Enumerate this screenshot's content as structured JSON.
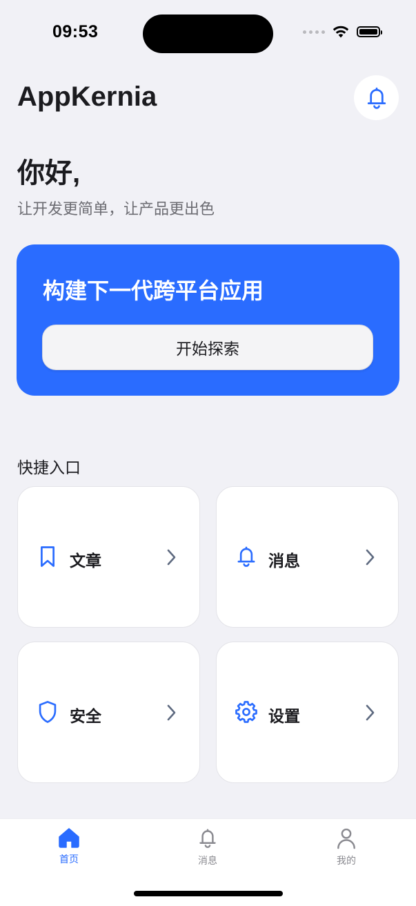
{
  "status_bar": {
    "time": "09:53"
  },
  "header": {
    "app_title": "AppKernia",
    "bell_icon": "bell-icon"
  },
  "greeting": {
    "title": "你好,",
    "subtitle": "让开发更简单，让产品更出色"
  },
  "hero": {
    "title": "构建下一代跨平台应用",
    "button_label": "开始探索",
    "color": "#2a6cff"
  },
  "quick_access": {
    "title": "快捷入口",
    "items": [
      {
        "label": "文章",
        "icon": "bookmark-icon"
      },
      {
        "label": "消息",
        "icon": "bell-icon"
      },
      {
        "label": "安全",
        "icon": "shield-icon"
      },
      {
        "label": "设置",
        "icon": "gear-icon"
      }
    ]
  },
  "tab_bar": {
    "items": [
      {
        "label": "首页",
        "icon": "home-icon",
        "active": true
      },
      {
        "label": "消息",
        "icon": "bell-icon",
        "active": false
      },
      {
        "label": "我的",
        "icon": "user-icon",
        "active": false
      }
    ],
    "active_color": "#2a6cff",
    "inactive_color": "#8a8a90"
  }
}
